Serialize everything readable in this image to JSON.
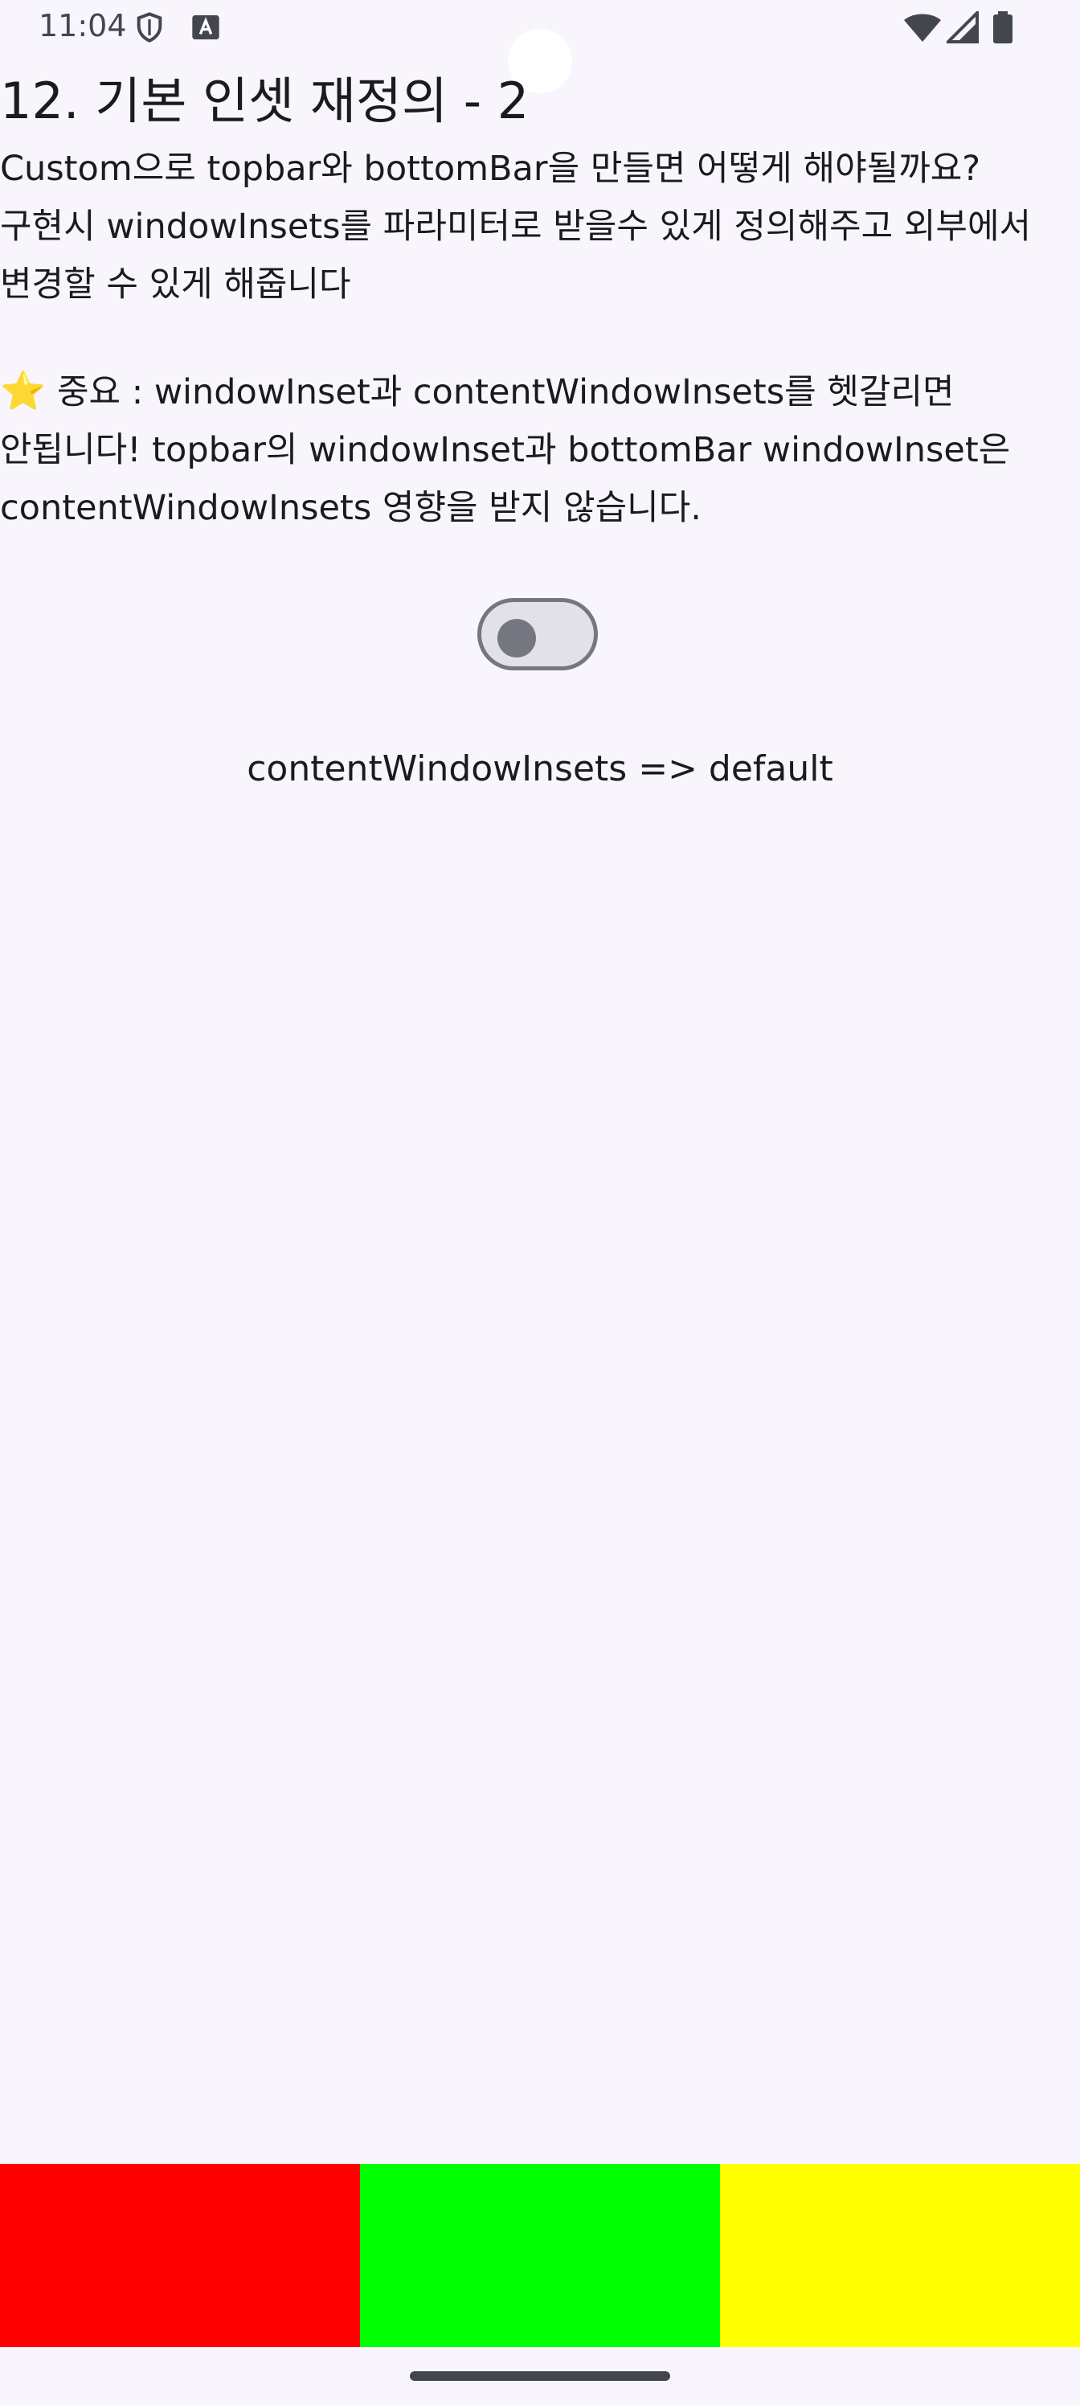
{
  "status_bar": {
    "time": "11:04",
    "left_icons": [
      "shield-icon",
      "keyboard-a-icon"
    ],
    "right_icons": [
      "wifi-icon",
      "cellular-signal-icon",
      "battery-icon"
    ]
  },
  "page": {
    "title": "12. 기본 인셋 재정의 - 2",
    "description_1": "Custom으로 topbar와 bottomBar을 만들면 어떻게 해야될까요? 구현시 windowInsets를 파라미터로 받을수 있게 정의해주고 외부에서 변경할 수 있게 해줍니다",
    "description_2_star": "⭐",
    "description_2": " 중요 : windowInset과 contentWindowInsets를 헷갈리면 안됩니다! topbar의 windowInset과 bottomBar windowInset은 contentWindowInsets 영향을 받지 않습니다.",
    "toggle_state": "off",
    "inset_label": "contentWindowInsets => default"
  },
  "bottom_bar": {
    "colors": [
      "#ff0000",
      "#00ff00",
      "#ffff00"
    ]
  },
  "colors": {
    "background": "#f8f6fc",
    "toggle_outline": "#74777f",
    "toggle_track": "#e2e1e9"
  }
}
